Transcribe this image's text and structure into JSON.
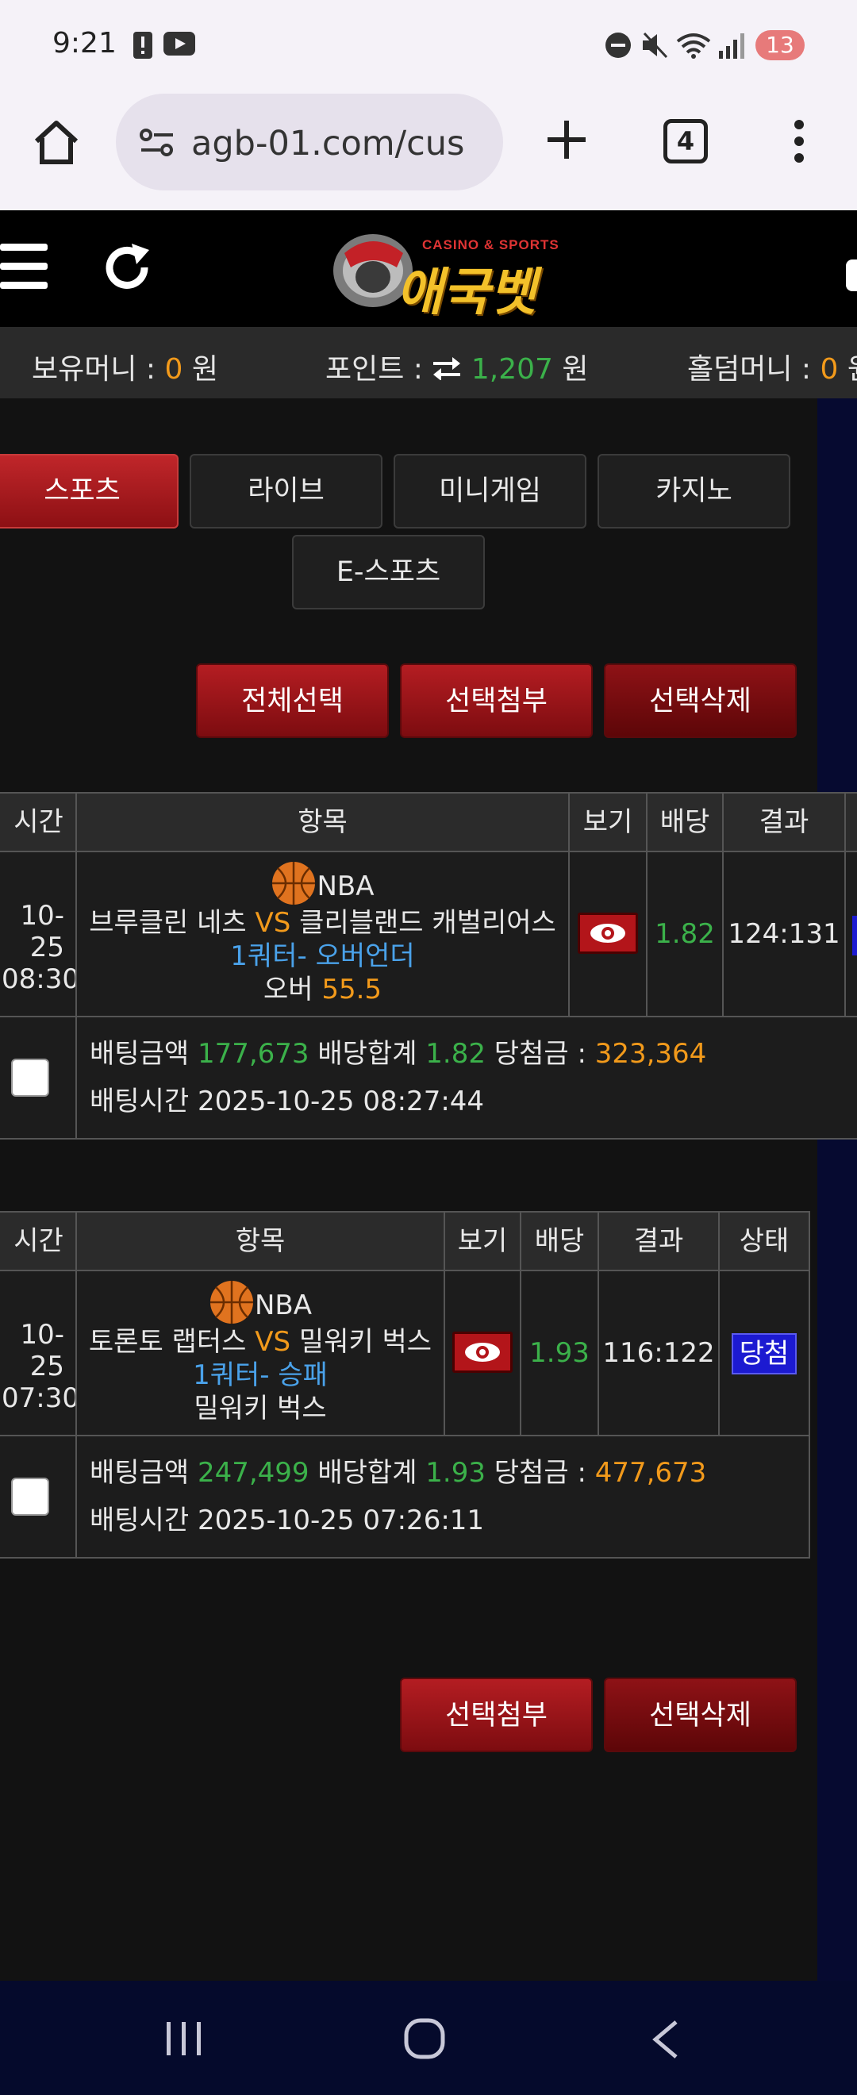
{
  "status_bar": {
    "time": "9:21",
    "notification_count": "13"
  },
  "browser": {
    "url": "agb-01.com/cus",
    "tab_count": "4"
  },
  "site": {
    "logo_sub": "CASINO & SPORTS",
    "logo_main": "애국벳"
  },
  "money_bar": {
    "holding_label": "보유머니 : ",
    "holding_value": "0",
    "holding_unit": " 원",
    "point_label": "포인트 : ",
    "point_value": "1,207",
    "point_unit": " 원",
    "holdem_label": "홀덤머니 : ",
    "holdem_value": "0",
    "holdem_unit": " 원"
  },
  "categories": [
    "스포츠",
    "라이브",
    "미니게임",
    "카지노",
    "E-스포츠"
  ],
  "actions": {
    "select_all": "전체선택",
    "attach_selected": "선택첨부",
    "delete_selected": "선택삭제"
  },
  "table_headers": {
    "time": "시간",
    "item": "항목",
    "view": "보기",
    "odds": "배당",
    "result": "결과",
    "status": "상태"
  },
  "bets": [
    {
      "date": "10-25",
      "time": "08:30",
      "league": "NBA",
      "home": "브루클린 네츠",
      "vs": "VS",
      "away": "클리블랜드 캐벌리어스",
      "market": "1쿼터- 오버언더",
      "pick_label": "오버 ",
      "pick_value": "55.5",
      "odds": "1.82",
      "result": "124:131",
      "bet_amount_label": "배팅금액 ",
      "bet_amount": "177,673",
      "odds_total_label": " 배당합계 ",
      "odds_total": "1.82",
      "win_label": " 당첨금 : ",
      "win_amount": "323,364",
      "bet_time_label": "배팅시간 ",
      "bet_time": "2025-10-25 08:27:44"
    },
    {
      "date": "10-25",
      "time": "07:30",
      "league": "NBA",
      "home": "토론토 랩터스",
      "vs": "VS",
      "away": "밀워키 벅스",
      "market": "1쿼터- 승패",
      "pick_label": "밀워키 벅스",
      "odds": "1.93",
      "result": "116:122",
      "status": "당첨",
      "bet_amount_label": "배팅금액 ",
      "bet_amount": "247,499",
      "odds_total_label": " 배당합계 ",
      "odds_total": "1.93",
      "win_label": " 당첨금 : ",
      "win_amount": "477,673",
      "bet_time_label": "배팅시간 ",
      "bet_time": "2025-10-25 07:26:11"
    }
  ]
}
